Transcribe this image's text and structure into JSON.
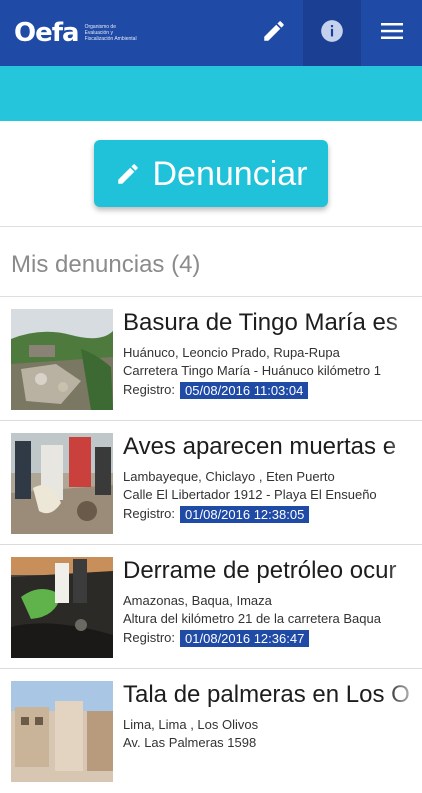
{
  "header": {
    "logo_text": "Oefa",
    "logo_subtitle": "Organismo de Evaluación y Fiscalización Ambiental",
    "color": "#1f4aa5",
    "icons": [
      "pencil-icon",
      "info-icon",
      "hamburger-menu-icon"
    ]
  },
  "main": {
    "denunciar_label": "Denunciar",
    "accent_color": "#1fc2d9",
    "section_title": "Mis denuncias (4)"
  },
  "denuncias": [
    {
      "title": "Basura de Tingo María es",
      "location": "Huánuco, Leoncio Prado, Rupa-Rupa",
      "address": "Carretera Tingo María - Huánuco kilómetro 1",
      "registro_label": "Registro:",
      "registro_date": "05/08/2016 11:03:04"
    },
    {
      "title": "Aves aparecen muertas e",
      "location": "Lambayeque, Chiclayo , Eten Puerto",
      "address": "Calle El Libertador 1912 - Playa El Ensueño",
      "registro_label": "Registro:",
      "registro_date": "01/08/2016 12:38:05"
    },
    {
      "title": "Derrame de petróleo ocur",
      "location": "Amazonas, Baqua, Imaza",
      "address": "Altura del kilómetro 21 de la carretera Baqua",
      "registro_label": "Registro:",
      "registro_date": "01/08/2016 12:36:47"
    },
    {
      "title": "Tala de palmeras en Los O",
      "location": "Lima, Lima , Los Olivos",
      "address": "Av. Las Palmeras 1598",
      "registro_label": "",
      "registro_date": ""
    }
  ]
}
